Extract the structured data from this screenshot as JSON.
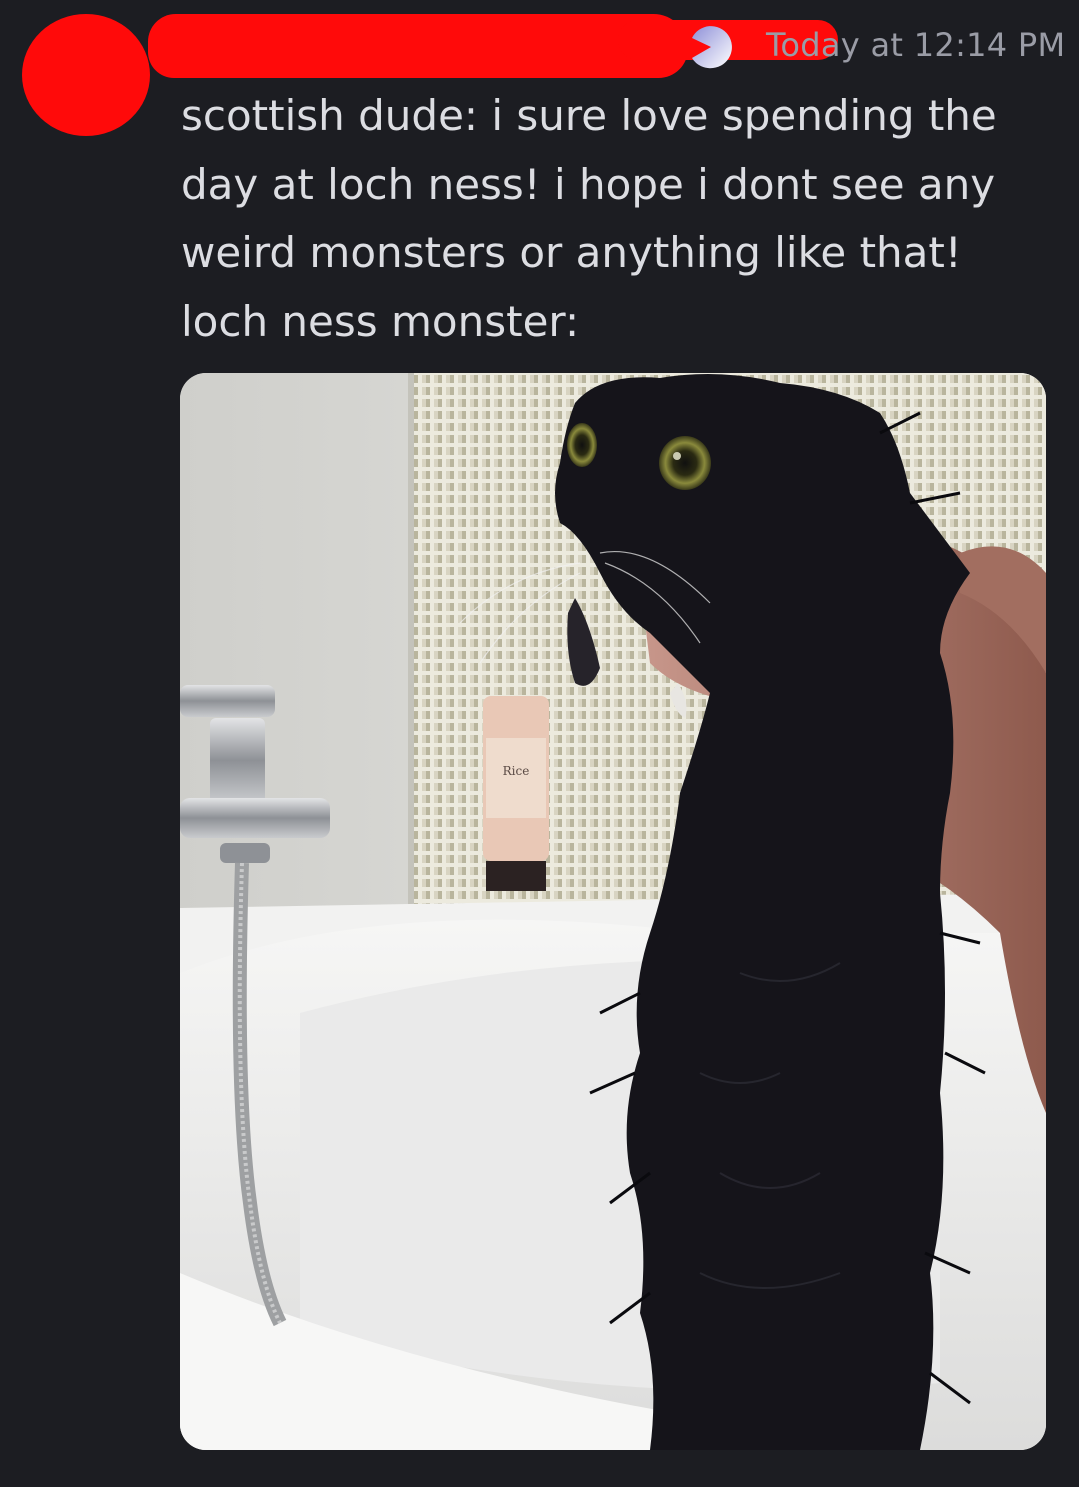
{
  "message": {
    "timestamp": "Today at 12:14 PM",
    "content_lines": [
      "scottish dude: i sure love spending the",
      "day at loch ness! i hope i dont see any",
      "weird monsters or anything like that!",
      "loch ness monster:"
    ],
    "avatar": "redacted",
    "username": "redacted",
    "badge_icon": "pacman-badge-icon"
  },
  "attachment": {
    "bottle_label": "Rice"
  },
  "colors": {
    "background": "#1c1d22",
    "message_text": "#dcdde2",
    "timestamp": "#9a9ca6",
    "redaction": "#ff0a0a"
  }
}
